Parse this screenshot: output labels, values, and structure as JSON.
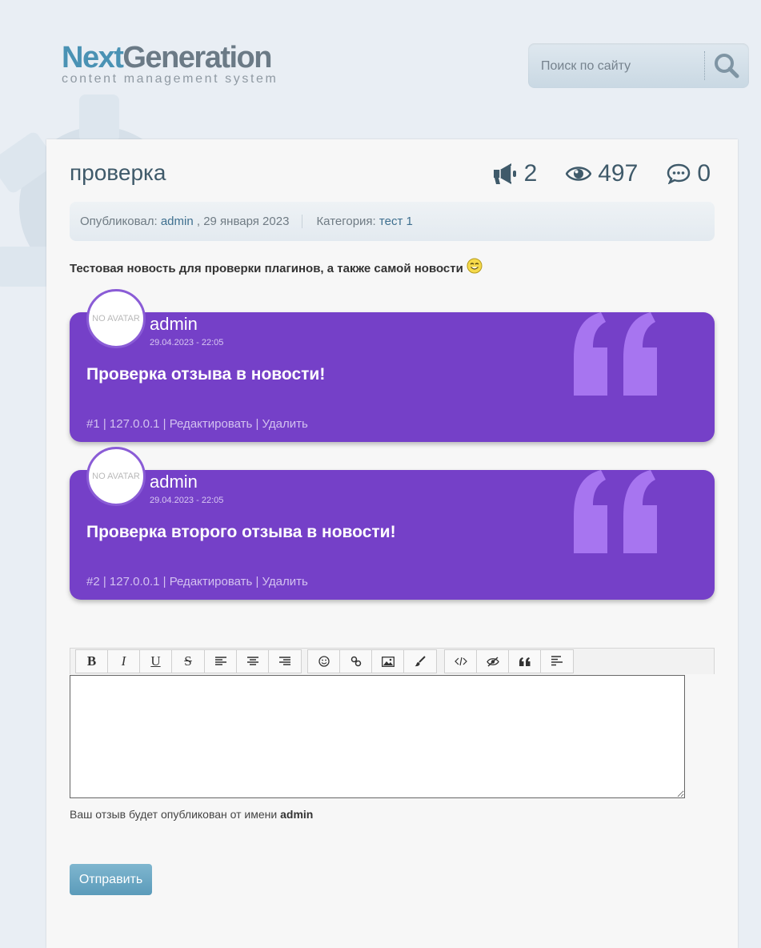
{
  "header": {
    "logo_part1": "Next",
    "logo_part2": "Generation",
    "logo_tagline": "content management system",
    "search_placeholder": "Поиск по сайту",
    "search_icon": "magnifier-icon"
  },
  "news": {
    "title": "проверка",
    "stats": {
      "shares": "2",
      "views": "497",
      "comments": "0"
    },
    "meta": {
      "published_label": "Опубликовал:",
      "author": "admin",
      "date": ", 29 января 2023",
      "category_label": "Категория:",
      "category": "тест 1"
    },
    "lead": "Тестовая новость для проверки плагинов, а также самой новости"
  },
  "comments": [
    {
      "avatar": "NO AVATAR",
      "author": "admin",
      "date": "29.04.2023 - 22:05",
      "text": "Проверка отзыва в новости!",
      "actions": "#1 | 127.0.0.1 | Редактировать | Удалить"
    },
    {
      "avatar": "NO AVATAR",
      "author": "admin",
      "date": "29.04.2023 - 22:05",
      "text": "Проверка второго отзыва в новости!",
      "actions": "#2 | 127.0.0.1 | Редактировать | Удалить"
    }
  ],
  "editor": {
    "toolbar": {
      "bold": "B",
      "italic": "I",
      "underline": "U",
      "strike": "S"
    },
    "textarea_value": "",
    "notice_prefix": "Ваш отзыв будет опубликован от имени ",
    "notice_user": "admin",
    "submit_label": "Отправить"
  },
  "colors": {
    "accent": "#7540c8",
    "title": "#3f5a6a",
    "link": "#3e6f8f",
    "button": "#5b9bba"
  }
}
